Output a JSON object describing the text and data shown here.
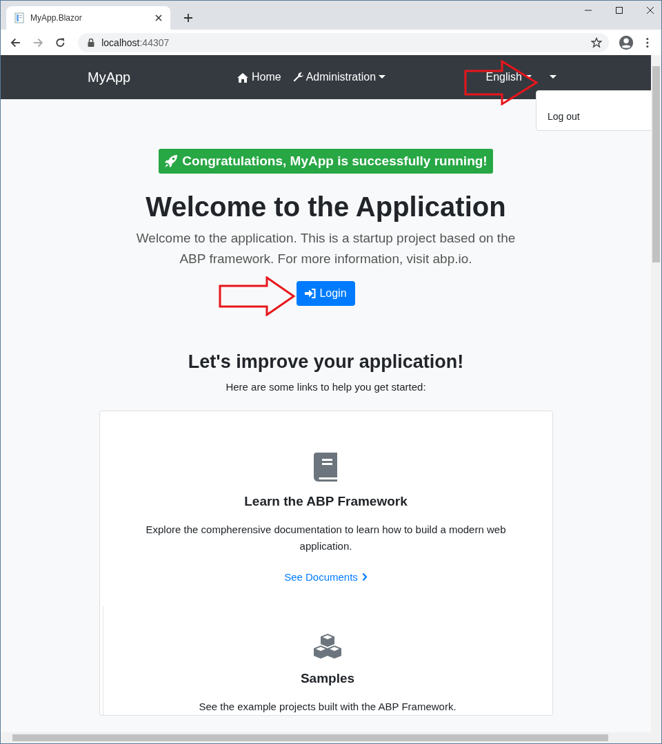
{
  "browser": {
    "tab_title": "MyApp.Blazor",
    "address_host": "localhost",
    "address_port": ":44307"
  },
  "navbar": {
    "brand": "MyApp",
    "items": [
      {
        "label": "Home",
        "dropdown": false
      },
      {
        "label": "Administration",
        "dropdown": true
      }
    ],
    "language": "English",
    "user_menu": {
      "items": [
        "Log out"
      ]
    }
  },
  "hero": {
    "badge": "Congratulations, **MyApp** is successfully running!",
    "title": "Welcome to the Application",
    "lead": "Welcome to the application. This is a startup project based on the ABP framework. For more information, visit abp.io.",
    "login_button": "Login"
  },
  "section": {
    "heading": "Let's improve your application!",
    "subheading": "Here are some links to help you get started:",
    "cards": [
      {
        "title": "Learn the ABP Framework",
        "text": "Explore the compherensive documentation to learn how to build a modern web application.",
        "link": "See Documents"
      },
      {
        "title": "Samples",
        "text": "See the example projects built with the ABP Framework."
      }
    ]
  }
}
